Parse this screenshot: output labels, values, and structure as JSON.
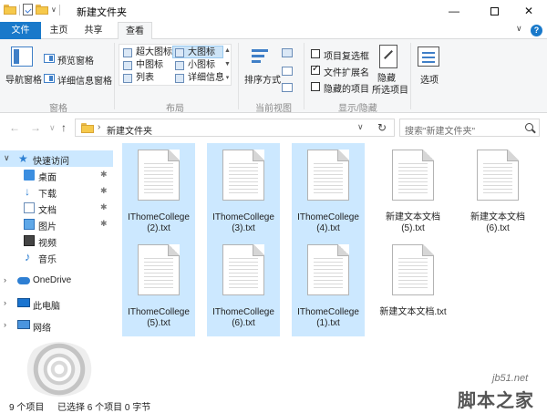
{
  "window": {
    "title": "新建文件夹",
    "min_glyph": "—",
    "close_glyph": "✕"
  },
  "tabs": {
    "file": "文件",
    "home": "主页",
    "share": "共享",
    "view": "查看",
    "collapse_glyph": "∨",
    "help_glyph": "?"
  },
  "ribbon": {
    "panes": {
      "nav_pane": "导航窗格",
      "preview_pane": "预览窗格",
      "details_pane": "详细信息窗格",
      "group": "窗格"
    },
    "layout": {
      "items": [
        "超大图标",
        "大图标",
        "中图标",
        "小图标",
        "列表",
        "详细信息"
      ],
      "selected": "大图标",
      "group": "布局"
    },
    "current_view": {
      "sort_by": "排序方式",
      "group": "当前视图"
    },
    "show_hide": {
      "item_checkboxes": "项目复选框",
      "file_extensions": "文件扩展名",
      "hidden_items": "隐藏的项目",
      "hide_selected_1": "隐藏",
      "hide_selected_2": "所选项目",
      "group": "显示/隐藏",
      "file_extensions_checked": true,
      "item_checkboxes_checked": false,
      "hidden_items_checked": false
    },
    "options": "选项"
  },
  "address": {
    "back": "←",
    "forward": "→",
    "recent": "∨",
    "up": "↑",
    "path": "新建文件夹",
    "path_sep": "›",
    "dropdown": "∨",
    "refresh": "↻",
    "search_placeholder": "搜索\"新建文件夹\""
  },
  "nav": {
    "quick_access": "快速访问",
    "desktop": "桌面",
    "downloads": "下载",
    "documents": "文档",
    "pictures": "图片",
    "videos": "视频",
    "music": "音乐",
    "onedrive": "OneDrive",
    "this_pc": "此电脑",
    "network": "网络",
    "pin": "✱",
    "star": "★",
    "down_arrow": "↓",
    "note": "♪",
    "chevron": "›"
  },
  "files": [
    {
      "name": "IThomeCollege (2).txt",
      "selected": true
    },
    {
      "name": "IThomeCollege (3).txt",
      "selected": true
    },
    {
      "name": "IThomeCollege (4).txt",
      "selected": true
    },
    {
      "name": "新建文本文档 (5).txt",
      "selected": false
    },
    {
      "name": "新建文本文档 (6).txt",
      "selected": false
    },
    {
      "name": "IThomeCollege (5).txt",
      "selected": true
    },
    {
      "name": "IThomeCollege (6).txt",
      "selected": true
    },
    {
      "name": "IThomeCollege (1).txt",
      "selected": true
    },
    {
      "name": "新建文本文档.txt",
      "selected": false
    }
  ],
  "status": {
    "count": "9 个项目",
    "selected": "已选择 6 个项目 0 字节"
  },
  "watermark": {
    "url": "jb51.net",
    "text": "脚本之家"
  }
}
